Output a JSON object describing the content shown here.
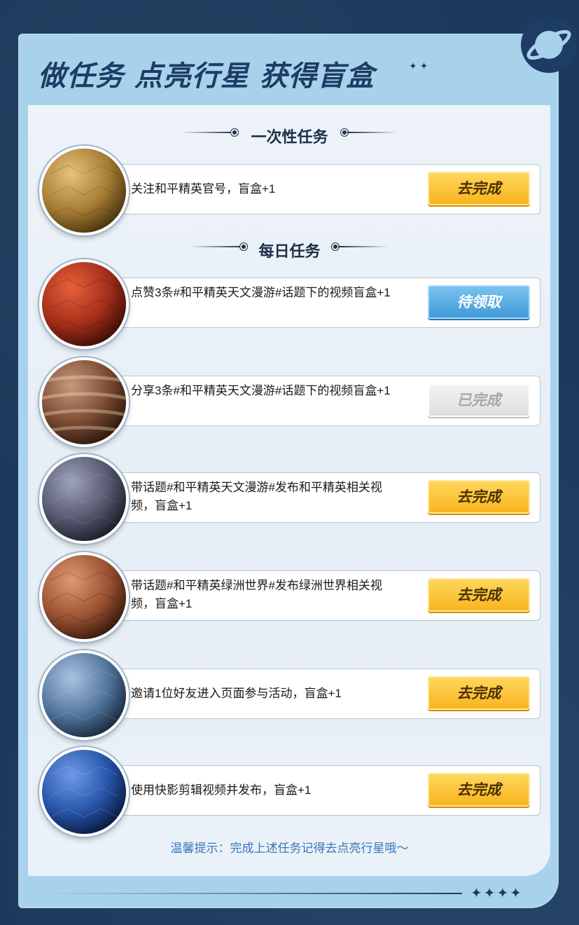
{
  "header": {
    "title": "做任务 点亮行星 获得盲盒"
  },
  "sections": {
    "once": "一次性任务",
    "daily": "每日任务"
  },
  "tasks": [
    {
      "text": "关注和平精英官号，盲盒+1",
      "button": "去完成",
      "state": "go",
      "planet_color": "#b08840"
    },
    {
      "text": "点赞3条#和平精英天文漫游#话题下的视频盲盒+1",
      "button": "待领取",
      "state": "claim",
      "planet_color": "#b33a22"
    },
    {
      "text": "分享3条#和平精英天文漫游#话题下的视频盲盒+1",
      "button": "已完成",
      "state": "done",
      "planet_color": "#8a5a40"
    },
    {
      "text": "带话题#和平精英天文漫游#发布和平精英相关视频，盲盒+1",
      "button": "去完成",
      "state": "go",
      "planet_color": "#5a5f78"
    },
    {
      "text": "带话题#和平精英绿洲世界#发布绿洲世界相关视频，盲盒+1",
      "button": "去完成",
      "state": "go",
      "planet_color": "#a0583a"
    },
    {
      "text": "邀请1位好友进入页面参与活动，盲盒+1",
      "button": "去完成",
      "state": "go",
      "planet_color": "#5c7fa8"
    },
    {
      "text": "使用快影剪辑视频并发布，盲盒+1",
      "button": "去完成",
      "state": "go",
      "planet_color": "#2858a8"
    }
  ],
  "tip": "温馨提示：完成上述任务记得去点亮行星哦～",
  "colors": {
    "accent_go": "#f8b21c",
    "accent_claim": "#3e98d8",
    "title": "#1d3d64",
    "frame": "#a8d2ec"
  }
}
